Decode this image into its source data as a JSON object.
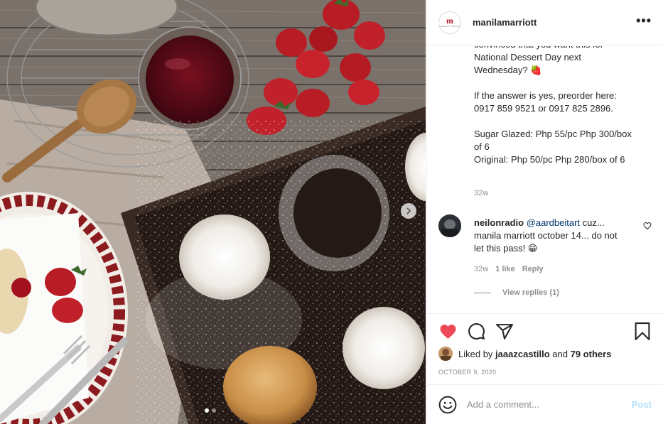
{
  "post": {
    "username": "manilamarriott",
    "logo_text": "MARRIOTT MANILA",
    "more_label": "•••",
    "caption": "convinced that you want this for\nNational Dessert Day next\nWednesday? 🍓\n\nIf the answer is yes, preorder here:\n0917 859 9521 or 0917 825 2896.\n\nSugar Glazed: Php 55/pc Php 300/box\nof 6\nOriginal: Php 50/pc Php 280/box of 6",
    "caption_time": "32w"
  },
  "comment": {
    "username": "neilonradio",
    "mention": "@aardbeitart",
    "text": " cuz... manila marriott october 14... do not let this pass! 😁",
    "time": "32w",
    "likes": "1 like",
    "reply_label": "Reply",
    "view_replies": "View replies (1)"
  },
  "likes": {
    "prefix": "Liked by ",
    "user": "jaaazcastillo",
    "middle": " and ",
    "others": "79 others"
  },
  "date": "OCTOBER 9, 2020",
  "add_comment": {
    "placeholder": "Add a comment...",
    "post_label": "Post"
  },
  "carousel": {
    "total": 2,
    "active": 1
  },
  "colors": {
    "heart_liked": "#ed4956",
    "post_disabled": "#b2dffc",
    "mention": "#00376b",
    "brand": "#b1182b"
  },
  "icons": [
    "heart-icon",
    "comment-icon",
    "share-icon",
    "bookmark-icon",
    "emoji-icon",
    "chevron-right-icon",
    "more-icon"
  ]
}
